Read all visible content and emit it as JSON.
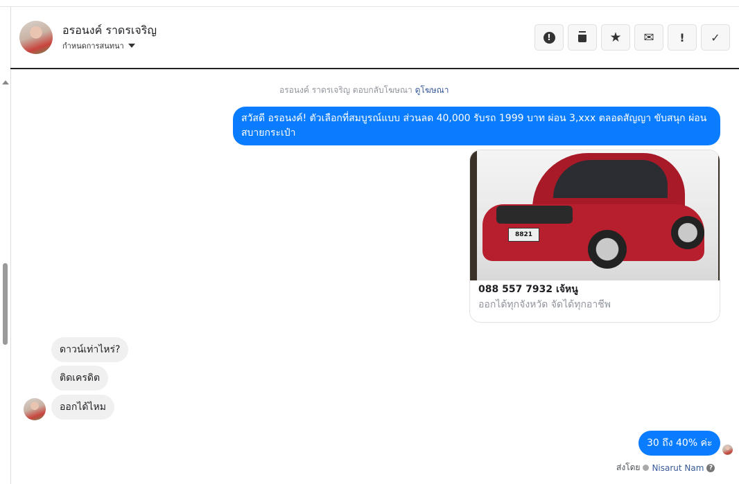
{
  "header": {
    "name": "อรอนงค์ ราดรเจริญ",
    "subtitle": "กำหนดการสนทนา"
  },
  "actions": [
    {
      "name": "report-icon",
      "glyph": "!"
    },
    {
      "name": "trash-icon",
      "glyph": "🗑"
    },
    {
      "name": "star-icon",
      "glyph": "★"
    },
    {
      "name": "mail-icon",
      "glyph": "✉"
    },
    {
      "name": "important-icon",
      "glyph": "!"
    },
    {
      "name": "check-icon",
      "glyph": "✓"
    }
  ],
  "notice": {
    "text": "อรอนงค์ ราดรเจริญ ตอบกลับโฆษณา ",
    "link": "ดูโฆษณา"
  },
  "messages": {
    "ad_text": "สวัสดี อรอนงค์! ตัวเลือกที่สมบูรณ์แบบ ส่วนลด 40,000 รับรถ 1999 บาท ผ่อน 3,xxx ตลอดสัญญา ขับสนุก ผ่อนสบายกระเป๋า",
    "card_title": "088 557 7932 เจ้หนู",
    "card_subtitle": "ออกได้ทุกจังหวัด จัดได้ทุกอาชีพ",
    "plate": "8821",
    "in1": "ดาวน์เท่าไหร่?",
    "in2": "ติดเครดิต",
    "in3": "ออกได้ไหม",
    "reply": "30 ถึง 40% ค่ะ"
  },
  "sent_by": {
    "label": "ส่งโดย",
    "name": "Nisarut Nam",
    "help": "?"
  },
  "colors": {
    "accent": "#0a7cff",
    "link": "#365899"
  }
}
